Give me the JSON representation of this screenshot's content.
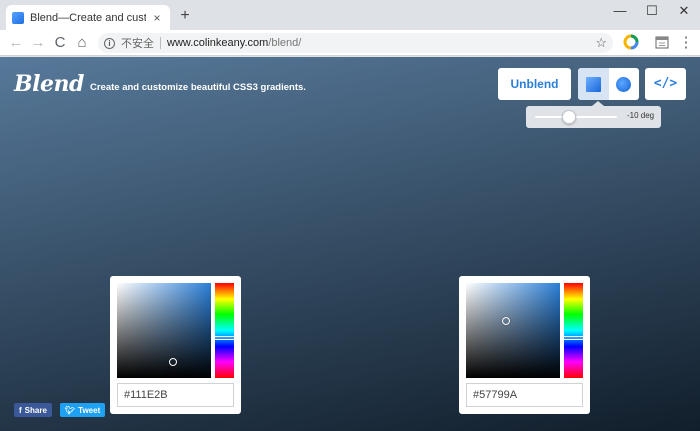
{
  "browser": {
    "tab_title": "Blend—Create and customize b",
    "tab_close": "×",
    "new_tab": "+",
    "minimize": "—",
    "maximize": "☐",
    "close": "✕",
    "back": "←",
    "forward": "→",
    "reload": "C",
    "home": "⌂",
    "insecure_label": "不安全",
    "url_host": "www.colinkeany.com",
    "url_path": "/blend/",
    "star": "☆",
    "menu": "⋮"
  },
  "app": {
    "logo": "Blend",
    "tagline": "Create and customize beautiful CSS3 gradients.",
    "unblend_label": "Unblend",
    "code_label": "</>",
    "angle_label": "-10 deg",
    "angle_value": -10,
    "angle_slider_fraction": 0.42
  },
  "pickers": [
    {
      "hex": "#111E2B",
      "base_hue_color": "#2a7fd8",
      "hue_fraction": 0.58,
      "sat": 0.6,
      "val": 0.17
    },
    {
      "hex": "#57799A",
      "base_hue_color": "#2a7fd8",
      "hue_fraction": 0.58,
      "sat": 0.43,
      "val": 0.6
    }
  ],
  "gradient": {
    "angle_deg": -10,
    "from": "#57799A",
    "to": "#111E2B"
  },
  "share": {
    "share_label": "Share",
    "tweet_label": "Tweet",
    "facebook_color": "#3b5998",
    "twitter_color": "#1da1f2"
  }
}
